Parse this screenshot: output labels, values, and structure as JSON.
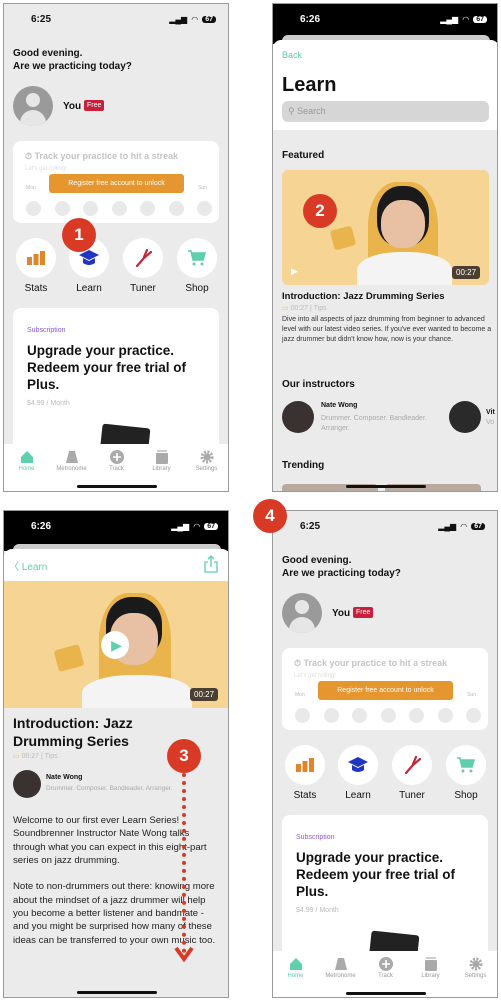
{
  "home": {
    "status_time": "6:25",
    "battery": "67",
    "greeting_line1": "Good evening.",
    "greeting_line2": "Are we practicing today?",
    "user_name": "You",
    "plan_badge": "Free",
    "streak_title": "Track your practice to hit a streak",
    "streak_subtitle": "Let's get rolling!",
    "register_button": "Register free account to unlock",
    "day_start": "Mon",
    "day_end": "Sun",
    "shortcuts": [
      {
        "label": "Stats",
        "icon": "bar-chart-icon"
      },
      {
        "label": "Learn",
        "icon": "graduation-cap-icon"
      },
      {
        "label": "Tuner",
        "icon": "tuning-fork-icon"
      },
      {
        "label": "Shop",
        "icon": "cart-icon"
      }
    ],
    "subscription_label": "Subscription",
    "subscription_line1": "Upgrade your practice.",
    "subscription_line2": "Redeem your free trial of",
    "subscription_line3": "Plus.",
    "price": "$4.99 / Month",
    "tabs": [
      {
        "label": "Home",
        "icon": "home-icon",
        "active": true
      },
      {
        "label": "Metronome",
        "icon": "metronome-icon"
      },
      {
        "label": "Track",
        "icon": "plus-circle-icon"
      },
      {
        "label": "Library",
        "icon": "library-icon"
      },
      {
        "label": "Settings",
        "icon": "gear-icon"
      }
    ]
  },
  "learn": {
    "status_time": "6:26",
    "battery": "67",
    "back": "Back",
    "title": "Learn",
    "search_placeholder": "Search",
    "featured_heading": "Featured",
    "featured_duration": "00:27",
    "featured_title": "Introduction: Jazz Drumming Series",
    "featured_meta": "00:27 | Tips",
    "featured_desc": "Dive into all aspects of jazz drumming from beginner to advanced level with our latest video series. If you've ever wanted to become a jazz drummer but didn't know how, now is your chance.",
    "instructors_heading": "Our instructors",
    "instructors": [
      {
        "name": "Nate Wong",
        "role": "Drummer. Composer. Bandleader. Arranger."
      },
      {
        "name": "Vit",
        "role": "Vo"
      }
    ],
    "trending_heading": "Trending"
  },
  "detail": {
    "status_time": "6:26",
    "battery": "67",
    "back": "Learn",
    "duration": "00:27",
    "title_line1": "Introduction: Jazz",
    "title_line2": "Drumming Series",
    "meta": "00:27 | Tips",
    "instructor_name": "Nate Wong",
    "instructor_role": "Drummer. Composer. Bandleader. Arranger.",
    "paragraph1": "Welcome to our first ever Learn Series! Soundbrenner Instructor Nate Wong talks through what you can expect in this eight-part series on jazz drumming.",
    "paragraph2": "Note to non-drummers out there: knowing more about the mindset of a jazz drummer will help you become a better listener and bandmate - and you might be surprised how many of these ideas can be transferred to your own music too."
  },
  "steps": [
    "1",
    "2",
    "3",
    "4"
  ],
  "colors": {
    "accent": "#5fcfae",
    "register": "#e5962f",
    "free_badge": "#c8203a",
    "subscription": "#8a5bd1",
    "step_badge": "#d83a26",
    "video_bg": "#f5d494"
  }
}
